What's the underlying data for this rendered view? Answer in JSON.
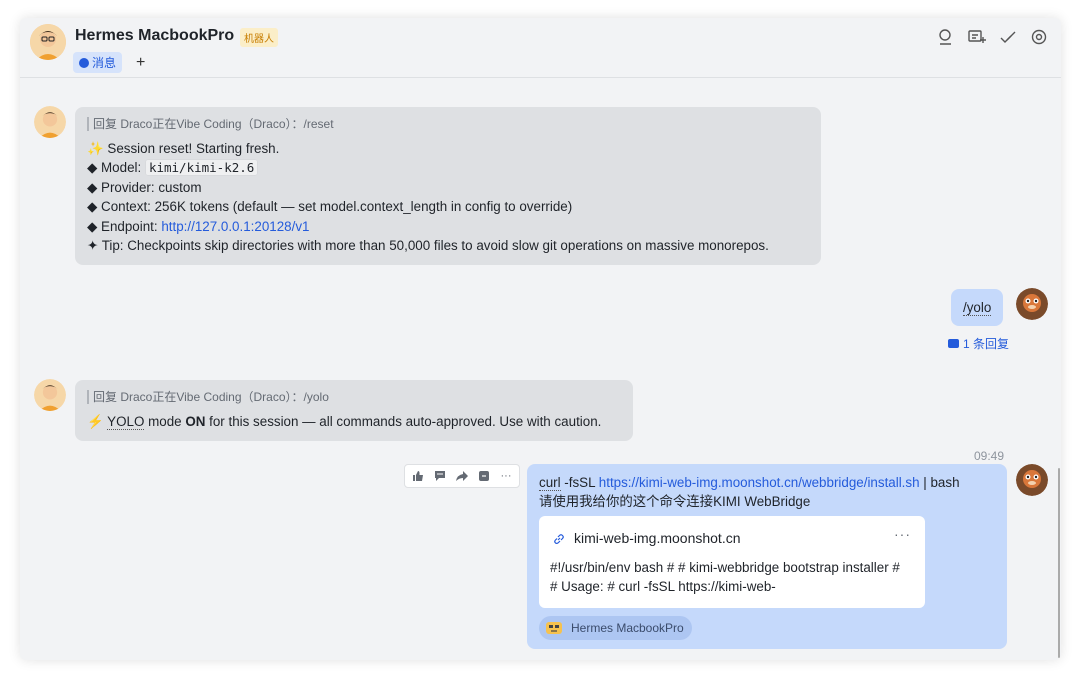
{
  "header": {
    "title": "Hermes MacbookPro",
    "bot_tag": "机器人",
    "tab_label": "消息",
    "add_tab": "+"
  },
  "messages": [
    {
      "quote": "回复 Draco正在Vibe Coding（Draco）：/reset",
      "line1_icon": "✨",
      "line1": " Session reset! Starting fresh.",
      "line2_prefix": "◆ Model: ",
      "line2_code": "kimi/kimi-k2.6",
      "line3": "◆ Provider: custom",
      "line4": "◆ Context: 256K tokens (default — set model.context_length in config to override)",
      "line5_prefix": "◆ Endpoint: ",
      "line5_link": "http://127.0.0.1:20128/v1",
      "line6": "✦ Tip: Checkpoints skip directories with more than 50,000 files to avoid slow git operations on massive monorepos."
    },
    {
      "text": "/yolo",
      "reply_count": "1 条回复"
    },
    {
      "quote": "回复 Draco正在Vibe Coding（Draco）：/yolo",
      "icon": "⚡",
      "pre": " ",
      "yolo": "YOLO",
      "mid": " mode ",
      "on": "ON",
      "post": " for this session — all commands auto-approved. Use with caution."
    },
    {
      "time": "09:49",
      "curl": "curl",
      "fs": " -fsSL ",
      "link": "https://kimi-web-img.moonshot.cn/webbridge/install.sh",
      "bash": " | bash",
      "line2": "请使用我给你的这个命令连接KIMI WebBridge",
      "card_title": "kimi-web-img.moonshot.cn",
      "card_more": "···",
      "card_body": "#!/usr/bin/env bash # # kimi-webbridge bootstrap installer # # Usage: # curl -fsSL https://kimi-web-",
      "source": "Hermes MacbookPro"
    }
  ],
  "toolbar_more": "···",
  "icons": [
    "search-icon",
    "add-chat-icon",
    "done-icon",
    "settings-icon",
    "thumbs-up-icon",
    "comment-icon",
    "forward-icon",
    "reply-icon",
    "more-icon",
    "link-icon"
  ],
  "colors": {
    "accent": "#245bdb",
    "bubble_gray": "#dee0e3",
    "bubble_blue": "#c5d9fb"
  }
}
